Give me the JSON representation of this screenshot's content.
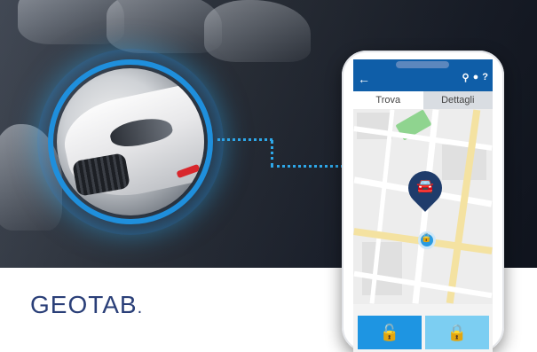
{
  "brand": {
    "logo_text": "GEOTAB",
    "logo_suffix": "."
  },
  "app": {
    "header": {
      "back_icon": "arrow-left-icon",
      "right_icons": [
        "location-pin-icon",
        "user-icon",
        "help-icon"
      ]
    },
    "tabs": [
      {
        "label": "Trova"
      },
      {
        "label": "Dettagli"
      }
    ],
    "map": {
      "marker_icon": "car-icon",
      "status_icon": "lock-icon"
    },
    "actions": {
      "lock_icon": "padlock-open-icon",
      "unlock_icon": "padlock-closed-icon"
    }
  },
  "colors": {
    "header_blue": "#0f5ea8",
    "accent_blue": "#2ea7e8",
    "pin_navy": "#1f3c6b",
    "logo_navy": "#2a3f78"
  }
}
